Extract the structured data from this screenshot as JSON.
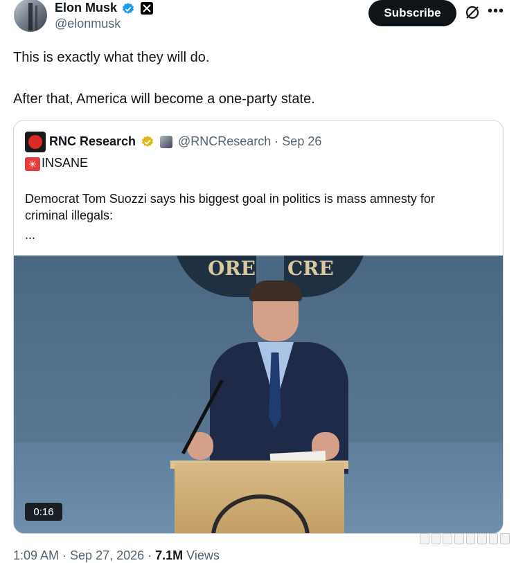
{
  "author": {
    "name": "Elon Musk",
    "handle": "@elonmusk",
    "verified_color": "#1d9bf0"
  },
  "header": {
    "subscribe_label": "Subscribe",
    "grok_icon": "slashed-circle-icon",
    "more_icon": "more-horizontal-icon",
    "more_label": "•••"
  },
  "tweet": {
    "line1": "This is exactly what they will do.",
    "line2": "After that, America will become a one-party state."
  },
  "quote": {
    "name": "RNC Research",
    "handle_date": "@RNCResearch · Sep 26",
    "verified_color": "#e2b719",
    "emoji": "✳",
    "tag": "INSANE",
    "text_line1": "Democrat Tom Suozzi says his biggest goal in politics is mass amnesty for",
    "text_line2": "criminal illegals:",
    "ellipsis": "...",
    "video": {
      "emblem_left": "ORE",
      "emblem_right": "CRE",
      "duration": "0:16"
    }
  },
  "footer": {
    "time_date": "1:09 AM · Sep 27, 2026 · ",
    "views_count": "7.1M",
    "views_label": " Views"
  }
}
